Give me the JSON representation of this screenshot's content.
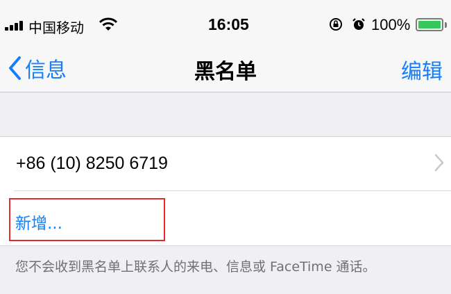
{
  "status_bar": {
    "carrier": "中国移动",
    "time": "16:05",
    "battery_percent": "100%",
    "battery_level": 1.0,
    "icons": [
      "signal-icon",
      "wifi-icon",
      "orientation-lock-icon",
      "alarm-icon",
      "battery-icon"
    ]
  },
  "nav": {
    "back_label": "信息",
    "title": "黑名单",
    "edit_label": "编辑"
  },
  "blocked": {
    "numbers": [
      "+86 (10) 8250 6719"
    ],
    "add_label": "新增..."
  },
  "footer_note": "您不会收到黑名单上联系人的来电、信息或 FaceTime 通话。",
  "colors": {
    "accent": "#147efb",
    "highlight_border": "#e12b2b",
    "background": "#efeff4",
    "battery": "#35c759"
  }
}
